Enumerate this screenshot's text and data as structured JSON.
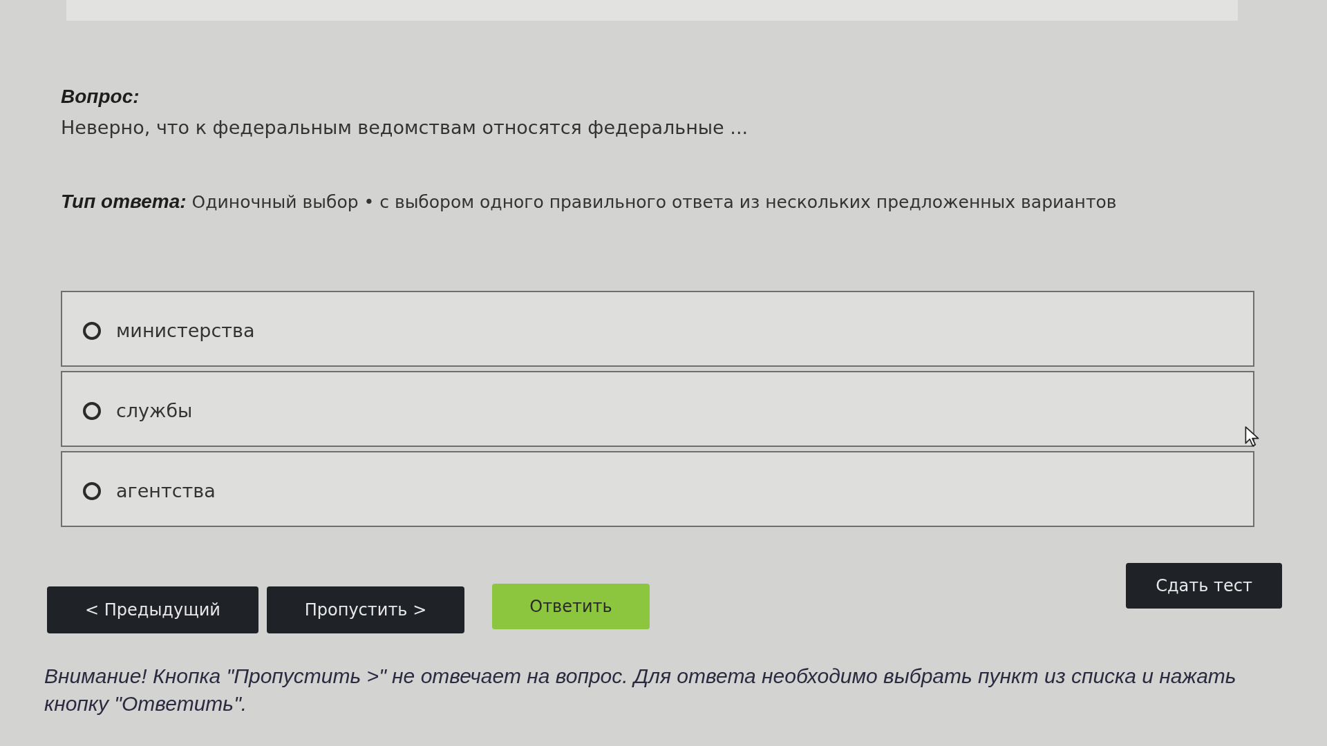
{
  "question": {
    "label": "Вопрос:",
    "text": "Неверно, что к федеральным ведомствам относятся федеральные ..."
  },
  "answer_type": {
    "label": "Тип ответа:",
    "value": "Одиночный выбор • с выбором одного правильного ответа из нескольких предложенных вариантов"
  },
  "options": [
    {
      "label": "министерства",
      "selected": false
    },
    {
      "label": "службы",
      "selected": false
    },
    {
      "label": "агентства",
      "selected": false
    }
  ],
  "buttons": [
    {
      "label": "< Предыдущий",
      "kind": "dark"
    },
    {
      "label": "Пропустить >",
      "kind": "dark"
    },
    {
      "label": "Ответить",
      "kind": "primary"
    },
    {
      "label": "Сдать тест",
      "kind": "submit"
    }
  ],
  "notice": "Внимание! Кнопка \"Пропустить >\" не отвечает на вопрос. Для ответа необходимо выбрать пункт из списка и нажать кнопку \"Ответить\"."
}
